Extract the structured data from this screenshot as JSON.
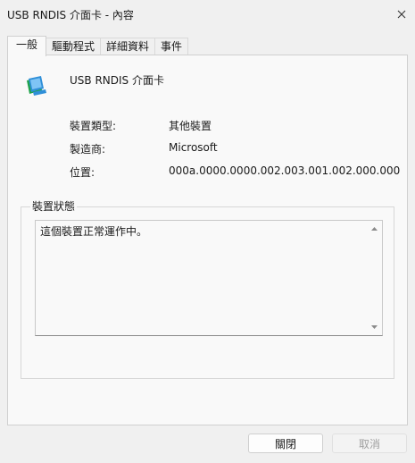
{
  "window": {
    "title": "USB RNDIS 介面卡 - 內容"
  },
  "tabs": [
    {
      "label": "一般"
    },
    {
      "label": "驅動程式"
    },
    {
      "label": "詳細資料"
    },
    {
      "label": "事件"
    }
  ],
  "device": {
    "name": "USB RNDIS 介面卡"
  },
  "properties": {
    "type_label": "裝置類型:",
    "type_value": "其他裝置",
    "manufacturer_label": "製造商:",
    "manufacturer_value": "Microsoft",
    "location_label": "位置:",
    "location_value": "000a.0000.0000.002.003.001.002.000.000"
  },
  "status": {
    "group_label": "裝置狀態",
    "text": "這個裝置正常運作中。"
  },
  "buttons": {
    "close_label": "關閉",
    "cancel_label": "取消"
  },
  "colors": {
    "icon_blue": "#2f8fd8",
    "icon_green": "#1fa34a"
  }
}
